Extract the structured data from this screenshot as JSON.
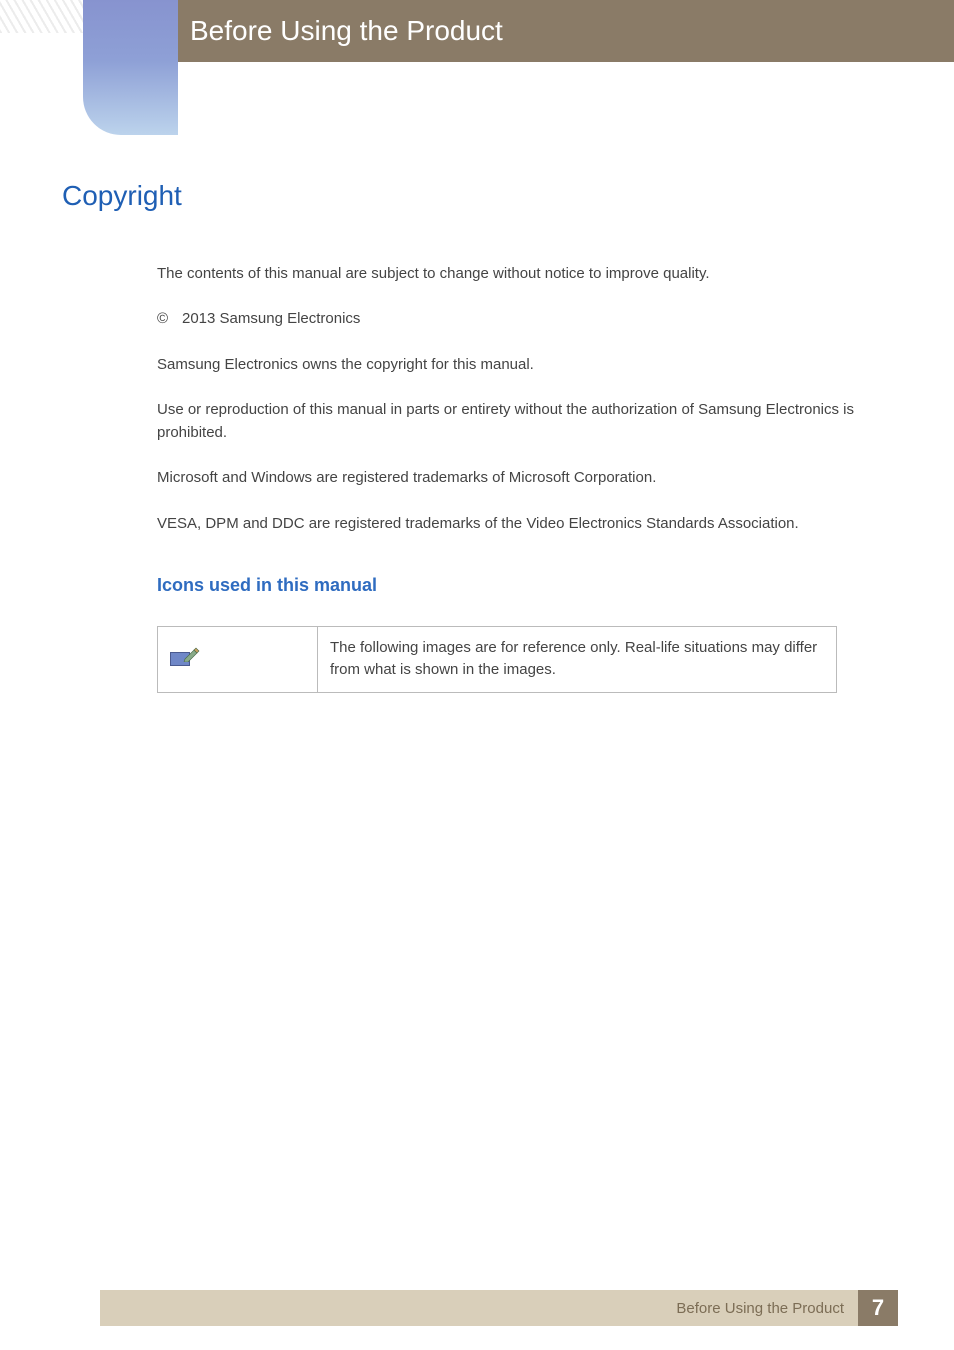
{
  "header": {
    "chapter_title": "Before Using the Product"
  },
  "section": {
    "title": "Copyright",
    "paragraphs": {
      "p1": "The contents of this manual are subject to change without notice to improve quality.",
      "cp_year_company": "2013 Samsung Electronics",
      "p2": "Samsung Electronics owns the copyright for this manual.",
      "p3": "Use or reproduction of this manual in parts or entirety without the authorization of Samsung Electronics is prohibited.",
      "p4": "Microsoft and Windows are registered trademarks of Microsoft Corporation.",
      "p5": "VESA, DPM and DDC are registered trademarks of the Video Electronics Standards Association."
    },
    "subheading": "Icons used in this manual",
    "icon_table": {
      "row1_text": "The following images are for reference only. Real-life situations may differ from what is shown in the images."
    }
  },
  "footer": {
    "label": "Before Using the Product",
    "page_number": "7"
  }
}
